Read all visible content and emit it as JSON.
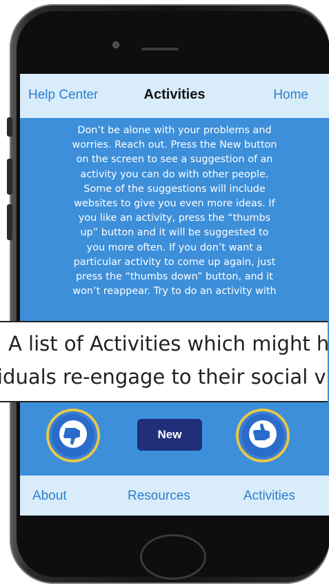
{
  "header": {
    "left_link": "Help Center",
    "title": "Activities",
    "right_link": "Home"
  },
  "description_lines": [
    "Don’t be alone with your problems and",
    "worries. Reach out. Press the New button",
    "on the screen to see a suggestion of an",
    "activity you can do with other people.",
    "Some of the suggestions will include",
    "websites to give you even more ideas. If",
    "you like an activity, press the “thumbs",
    "up” button and it will be suggested to",
    "you more often. If you don’t want a",
    "particular activity to come up again, just",
    "press the “thumbs down” button, and it",
    "won’t reappear. Try to do an activity with"
  ],
  "actions": {
    "new_label": "New"
  },
  "tabbar": {
    "about": "About",
    "resources": "Resources",
    "activities": "Activities"
  },
  "caption": {
    "line1": "A list of Activities which might h",
    "line2": "iduals re-engage to their social v"
  },
  "colors": {
    "screen_bg": "#3d8fd9",
    "bar_bg": "#d8ecfa",
    "link": "#2f7fcc",
    "new_button": "#1f2f7a",
    "ring": "#e8c84a"
  },
  "icons": [
    "thumbs-down-icon",
    "thumbs-up-icon"
  ]
}
